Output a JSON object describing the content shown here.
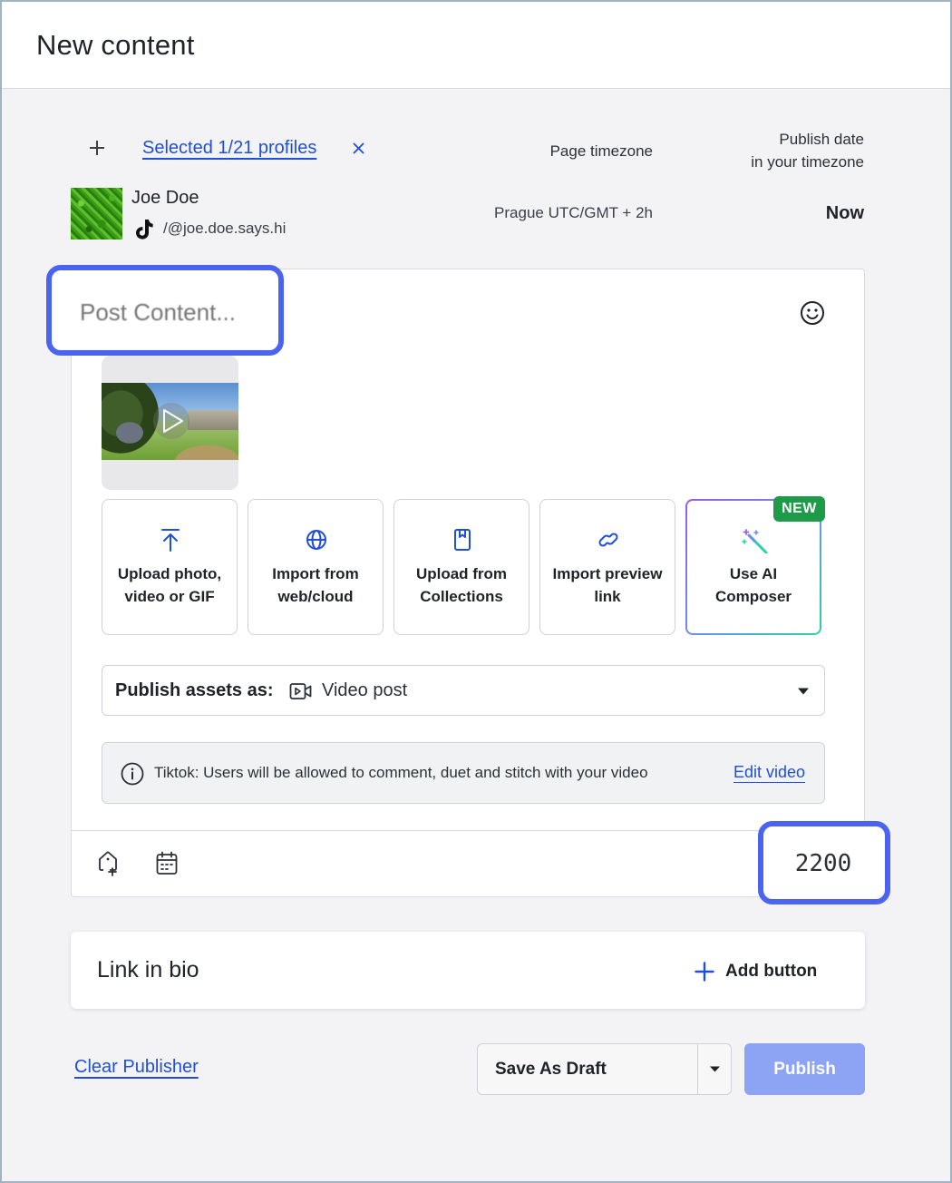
{
  "header": {
    "title": "New content"
  },
  "profiles": {
    "selected_label": "Selected 1/21 profiles",
    "page_timezone_label": "Page timezone",
    "publish_date_label_line1": "Publish date",
    "publish_date_label_line2": "in your timezone",
    "items": [
      {
        "name": "Joe Doe",
        "handle": "/@joe.doe.says.hi",
        "timezone": "Prague UTC/GMT + 2h",
        "publish_date": "Now",
        "network_icon": "tiktok-icon"
      }
    ]
  },
  "editor": {
    "placeholder": "Post Content...",
    "emoji_icon": "smiley-icon",
    "tiles": [
      {
        "label_line1": "Upload photo,",
        "label_line2": "video or GIF",
        "icon": "upload-icon"
      },
      {
        "label_line1": "Import from",
        "label_line2": "web/cloud",
        "icon": "globe-icon"
      },
      {
        "label_line1": "Upload from",
        "label_line2": "Collections",
        "icon": "bookmark-icon"
      },
      {
        "label_line1": "Import preview",
        "label_line2": "link",
        "icon": "link-icon"
      },
      {
        "label_line1": "Use AI",
        "label_line2": "Composer",
        "icon": "magic-wand-icon",
        "badge": "NEW"
      }
    ],
    "publish_as": {
      "label": "Publish assets as:",
      "value": "Video post",
      "icon": "video-icon"
    },
    "info": {
      "text": "Tiktok: Users will be allowed to comment, duet and stitch with your video",
      "link": "Edit video"
    },
    "char_counter": "2200",
    "colors": {
      "accent": "#1f4fd6",
      "highlight": "#4a63f0",
      "badge": "#1d9b48",
      "publish": "#8da3f4"
    }
  },
  "link_in_bio": {
    "title": "Link in bio",
    "add_button": "Add button"
  },
  "actions": {
    "clear": "Clear Publisher",
    "save_draft": "Save As Draft",
    "publish": "Publish"
  }
}
